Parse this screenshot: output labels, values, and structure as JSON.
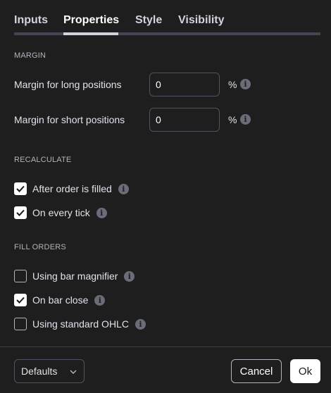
{
  "tabs": [
    {
      "label": "Inputs",
      "active": false
    },
    {
      "label": "Properties",
      "active": true
    },
    {
      "label": "Style",
      "active": false
    },
    {
      "label": "Visibility",
      "active": false
    }
  ],
  "margin": {
    "title": "MARGIN",
    "long": {
      "label": "Margin for long positions",
      "value": "0",
      "unit": "%"
    },
    "short": {
      "label": "Margin for short positions",
      "value": "0",
      "unit": "%"
    }
  },
  "recalculate": {
    "title": "RECALCULATE",
    "items": [
      {
        "label": "After order is filled",
        "checked": true
      },
      {
        "label": "On every tick",
        "checked": true
      }
    ]
  },
  "fill_orders": {
    "title": "FILL ORDERS",
    "items": [
      {
        "label": "Using bar magnifier",
        "checked": false
      },
      {
        "label": "On bar close",
        "checked": true
      },
      {
        "label": "Using standard OHLC",
        "checked": false
      }
    ]
  },
  "footer": {
    "defaults_label": "Defaults",
    "cancel_label": "Cancel",
    "ok_label": "Ok"
  },
  "icons": {
    "info": "info-icon",
    "check": "check-icon",
    "chevron": "chevron-down-icon"
  }
}
